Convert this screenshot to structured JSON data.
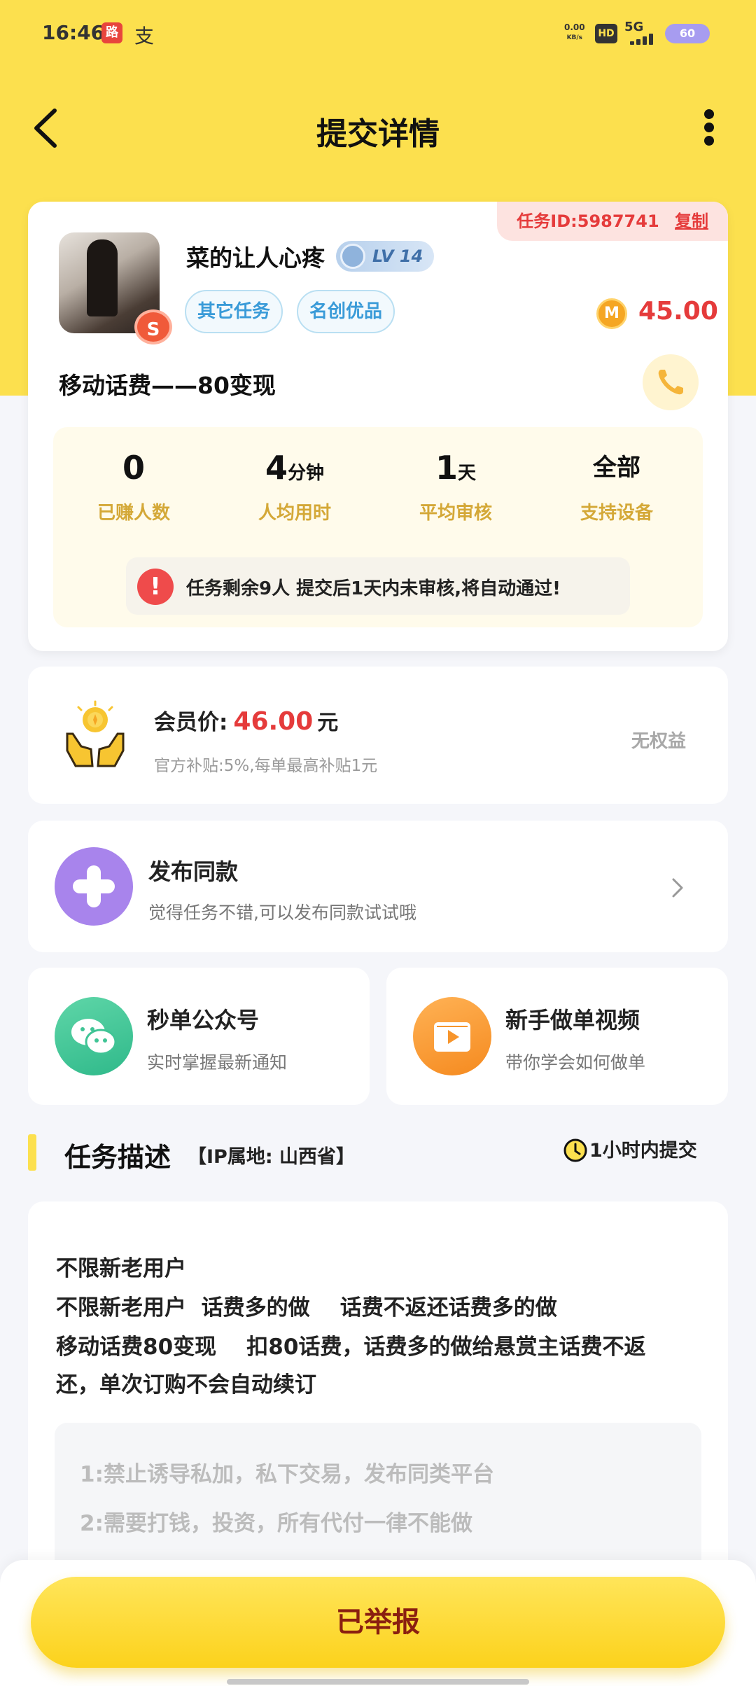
{
  "status_bar": {
    "time": "16:46",
    "app_icon_1": "路",
    "app_icon_2": "支",
    "net_speed_value": "0.00",
    "net_speed_unit": "KB/s",
    "hd": "HD",
    "network": "5G",
    "battery": "60"
  },
  "header": {
    "title": "提交详情",
    "back_icon": "chevron-left-icon",
    "more_icon": "more-vertical-icon"
  },
  "task_card": {
    "task_id_label": "任务ID:5987741",
    "copy_label": "复制",
    "username": "菜的让人心疼",
    "level": "LV 14",
    "badge": "S",
    "tags": [
      "其它任务",
      "名创优品"
    ],
    "coin_icon": "M",
    "price": "45.00",
    "title": "移动话费——80变现",
    "stats": [
      {
        "value": "0",
        "unit": "",
        "label": "已赚人数"
      },
      {
        "value": "4",
        "unit": "分钟",
        "label": "人均用时"
      },
      {
        "value": "1",
        "unit": "天",
        "label": "平均审核"
      },
      {
        "value": "全部",
        "unit": "",
        "label": "支持设备"
      }
    ],
    "notice": "任务剩余9人   提交后1天内未审核,将自动通过!"
  },
  "member": {
    "label": "会员价:",
    "amount": "46.00",
    "unit": "元",
    "sub": "官方补贴:5%,每单最高补贴1元",
    "right": "无权益"
  },
  "publish_same": {
    "title": "发布同款",
    "sub": "觉得任务不错,可以发布同款试试哦"
  },
  "wechat": {
    "title": "秒单公众号",
    "sub": "实时掌握最新通知"
  },
  "video": {
    "title": "新手做单视频",
    "sub": "带你学会如何做单"
  },
  "section": {
    "title": "任务描述",
    "ip": "【IP属地: 山西省】",
    "deadline": "1小时内提交"
  },
  "description": {
    "lines": [
      "不限新老用户",
      "不限新老用户  话费多的做    话费不返还话费多的做",
      "移动话费80变现    扣80话费，话费多的做给悬赏主话费不返",
      "还，单次订购不会自动续订"
    ],
    "rules": [
      "1:禁止诱导私加，私下交易，发布同类平台",
      "2:需要打钱，投资，所有代付一律不能做"
    ]
  },
  "bottom": {
    "button": "已举报"
  },
  "colors": {
    "brand_yellow": "#fce04e",
    "price_red": "#e53b3b",
    "tag_blue": "#3a9bd8",
    "stat_gold": "#d4a837"
  }
}
